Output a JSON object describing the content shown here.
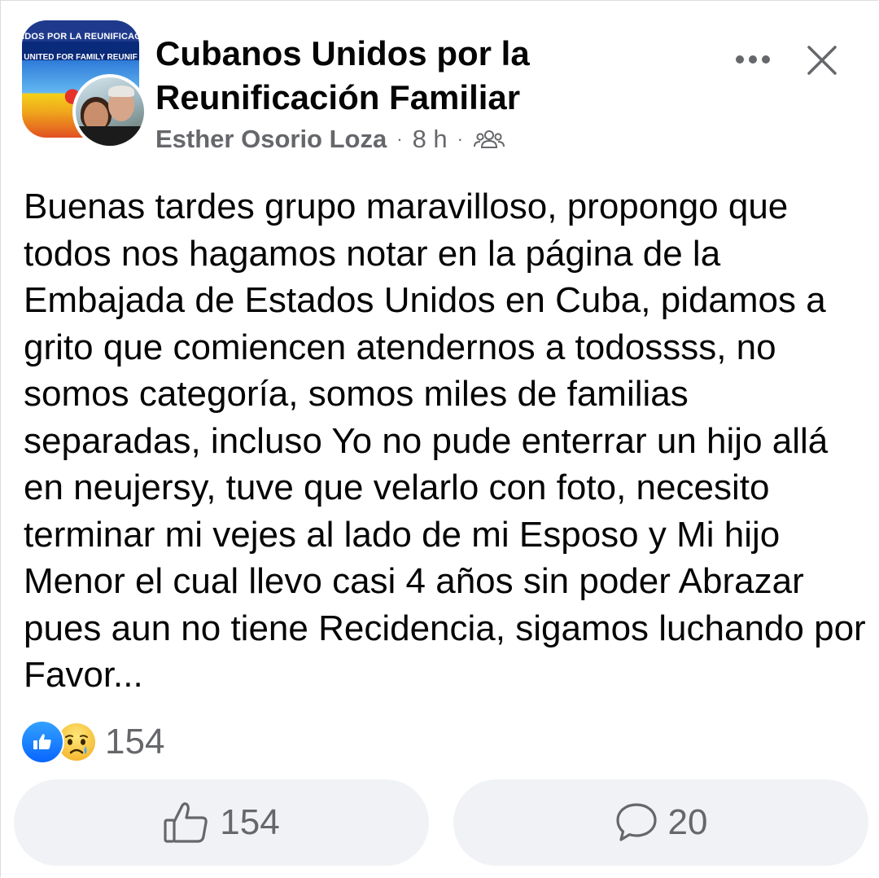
{
  "header": {
    "group_avatar": {
      "banner_line1": "IDOS POR LA REUNIFICACI",
      "banner_line2": "UNITED FOR FAMILY REUNIF"
    },
    "group_name": "Cubanos Unidos por la Reunificación Familiar",
    "author": "Esther Osorio Loza",
    "separator": "·",
    "time": "8 h",
    "audience_icon": "group-members-icon",
    "more_icon": "more-options-icon",
    "close_icon": "close-icon"
  },
  "post": {
    "text": "Buenas tardes grupo maravilloso, propongo que todos nos hagamos notar en la página de la Embajada de Estados Unidos en Cuba, pidamos a grito que comiencen atendernos a todossss, no somos categoría, somos miles de familias separadas, incluso Yo no pude enterrar un hijo allá en neujersy, tuve que velarlo con foto, necesito terminar mi vejes al lado de mi Esposo y Mi hijo Menor el cual llevo casi 4 años sin poder Abrazar pues aun no tiene Recidencia, sigamos luchando por Favor..."
  },
  "reactions": {
    "icons": [
      "like-icon",
      "sad-icon"
    ],
    "count": "154"
  },
  "actions": {
    "like": {
      "icon": "thumbs-up-icon",
      "label": "154"
    },
    "comment": {
      "icon": "comment-bubble-icon",
      "label": "20"
    }
  },
  "colors": {
    "text_primary": "#050505",
    "text_secondary": "#65676b",
    "button_bg": "#f0f2f5",
    "like_blue": "#0866ff",
    "sad_yellow": "#f7c33c"
  }
}
